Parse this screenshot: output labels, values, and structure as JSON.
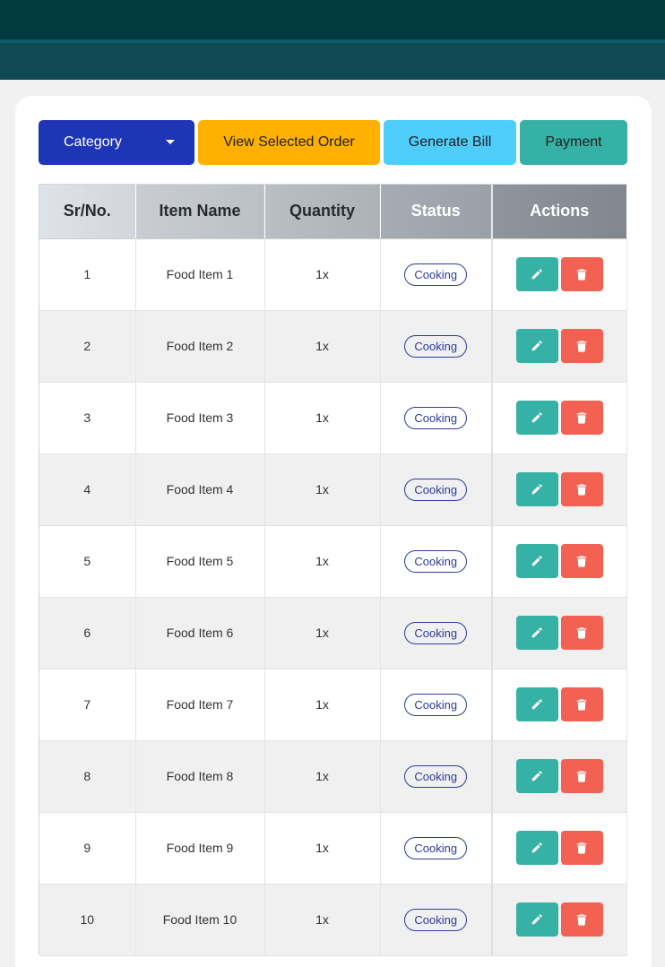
{
  "toolbar": {
    "category_label": "Category",
    "view_order_label": "View Selected Order",
    "generate_bill_label": "Generate Bill",
    "payment_label": "Payment"
  },
  "table": {
    "headers": [
      "Sr/No.",
      "Item Name",
      "Quantity",
      "Status",
      "Actions"
    ],
    "rows": [
      {
        "sr": "1",
        "name": "Food Item 1",
        "qty": "1x",
        "status": "Cooking"
      },
      {
        "sr": "2",
        "name": "Food Item 2",
        "qty": "1x",
        "status": "Cooking"
      },
      {
        "sr": "3",
        "name": "Food Item 3",
        "qty": "1x",
        "status": "Cooking"
      },
      {
        "sr": "4",
        "name": "Food Item 4",
        "qty": "1x",
        "status": "Cooking"
      },
      {
        "sr": "5",
        "name": "Food Item 5",
        "qty": "1x",
        "status": "Cooking"
      },
      {
        "sr": "6",
        "name": "Food Item 6",
        "qty": "1x",
        "status": "Cooking"
      },
      {
        "sr": "7",
        "name": "Food Item 7",
        "qty": "1x",
        "status": "Cooking"
      },
      {
        "sr": "8",
        "name": "Food Item 8",
        "qty": "1x",
        "status": "Cooking"
      },
      {
        "sr": "9",
        "name": "Food Item 9",
        "qty": "1x",
        "status": "Cooking"
      },
      {
        "sr": "10",
        "name": "Food Item 10",
        "qty": "1x",
        "status": "Cooking"
      }
    ]
  },
  "icons": {
    "edit": "pencil-icon",
    "delete": "trash-icon",
    "dropdown": "caret-down-icon"
  },
  "colors": {
    "header_dark": "#023b3f",
    "header_band": "#0f4a54",
    "category": "#1e35b6",
    "view_order": "#ffb000",
    "generate_bill": "#4fcdfb",
    "payment": "#36b1a6",
    "edit": "#36b1a6",
    "delete": "#f36152",
    "badge": "#2b3b9e"
  }
}
